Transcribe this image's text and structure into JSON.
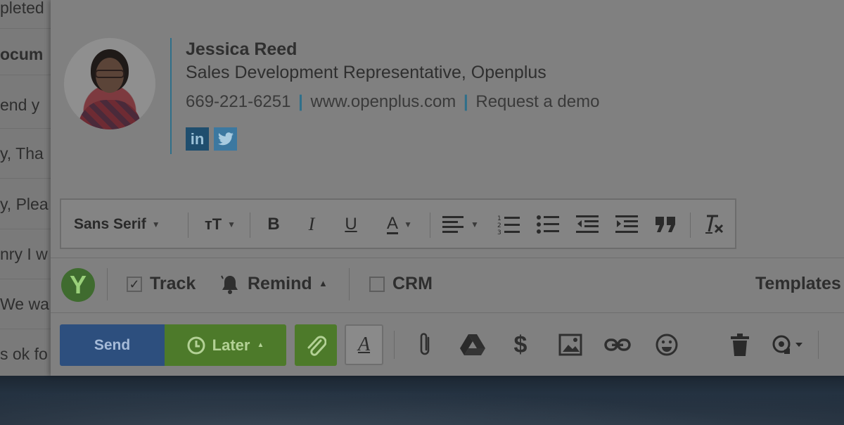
{
  "left_list": {
    "rows": [
      "pleted",
      "ocum",
      "end y",
      "y, Tha",
      "y, Plea",
      "nry I w",
      "We wa",
      "s ok fo"
    ]
  },
  "signature": {
    "name": "Jessica Reed",
    "title": "Sales Development Representative, Openplus",
    "phone": "669-221-6251",
    "website": "www.openplus.com",
    "demo_link": "Request a demo",
    "separator": "|",
    "social": [
      {
        "icon": "linkedin-icon",
        "label": "in"
      },
      {
        "icon": "twitter-icon",
        "label": "🐦"
      }
    ]
  },
  "format_toolbar": {
    "font": "Sans Serif",
    "size_icon": "text-size-icon",
    "bold": "B",
    "italic": "I",
    "underline": "U",
    "text_color": "A",
    "align_icon": "align-left-icon",
    "numbered_list_icon": "numbered-list-icon",
    "bulleted_list_icon": "bulleted-list-icon",
    "indent_less_icon": "indent-less-icon",
    "indent_more_icon": "indent-more-icon",
    "quote_icon": "quote-icon",
    "clear_format_icon": "remove-formatting-icon"
  },
  "action_row": {
    "logo": "Y",
    "track_label": "Track",
    "track_checked": true,
    "remind_label": "Remind",
    "crm_label": "CRM",
    "crm_checked": false,
    "templates_label": "Templates"
  },
  "send_bar": {
    "send_label": "Send",
    "later_label": "Later",
    "format_label": "A"
  },
  "colors": {
    "send": "#2d4f7e",
    "later": "#4d7a2a",
    "accent": "#2f6f8a"
  }
}
